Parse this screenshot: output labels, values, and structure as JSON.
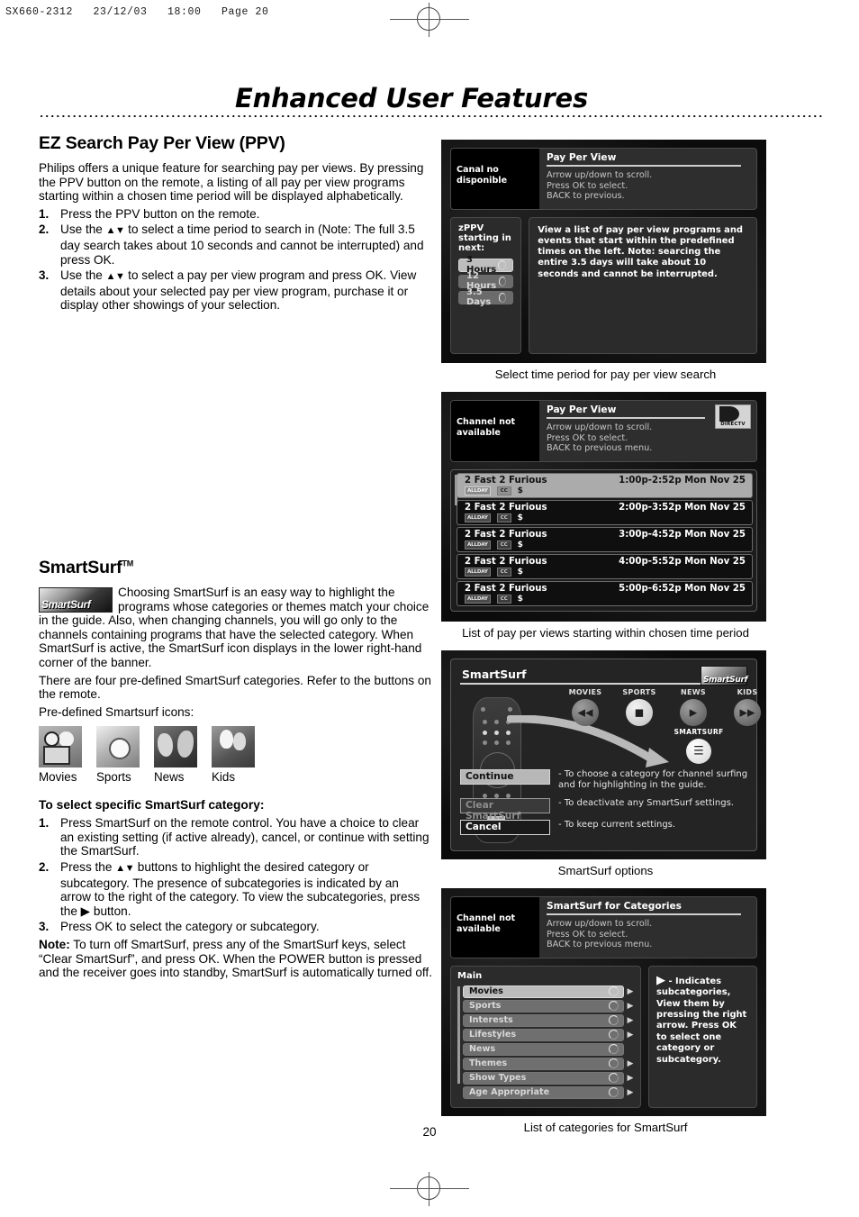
{
  "print_header": "SX660-2312   23/12/03   18:00   Page 20",
  "page_title": "Enhanced User Features",
  "page_number": "20",
  "left_column": {
    "ppv": {
      "heading": "EZ Search Pay Per View (PPV)",
      "intro": "Philips offers a unique feature for searching pay per views. By pressing the PPV button on the remote, a listing of all pay per view programs starting within a chosen time period will be displayed alphabetically.",
      "steps": [
        {
          "num": "1.",
          "text": "Press the PPV button on the remote."
        },
        {
          "num": "2.",
          "text_before": "Use the ",
          "arrows": "▲▼",
          "text_after": " to select a time period to search in (Note: The full 3.5 day search takes about 10 seconds and cannot be interrupted) and press OK."
        },
        {
          "num": "3.",
          "text_before": "Use the ",
          "arrows": "▲▼",
          "text_after": " to select a pay per view program and press OK. View details about your selected pay per view program, purchase it or display other showings of your selection."
        }
      ]
    },
    "smartsurf": {
      "heading": "SmartSurf",
      "heading_tm": "TM",
      "logo_text": "SmartSurf",
      "para1": "Choosing SmartSurf is an easy way to highlight the programs whose categories or themes match your choice in the guide. Also, when changing channels, you will go only to the channels containing programs that have the selected category. When SmartSurf is active, the SmartSurf icon displays in the lower right-hand corner of the banner.",
      "para2": "There are four pre-defined SmartSurf categories. Refer to the buttons on the remote.",
      "para3": "Pre-defined Smartsurf icons:",
      "icons": [
        {
          "label": "Movies",
          "icon": "movies-icon"
        },
        {
          "label": "Sports",
          "icon": "sports-icon"
        },
        {
          "label": "News",
          "icon": "news-icon"
        },
        {
          "label": "Kids",
          "icon": "kids-icon"
        }
      ]
    },
    "select_category": {
      "heading": "To select specific SmartSurf category:",
      "steps": [
        {
          "num": "1.",
          "text": "Press SmartSurf on the remote control. You have a choice to clear an existing setting (if active already), cancel, or continue with setting the SmartSurf."
        },
        {
          "num": "2.",
          "text_before": "Press the ",
          "arrows": "▲▼",
          "text_after": " buttons to highlight the desired category or subcategory. The presence of subcategories is indicated by an arrow to the right of the category. To view the subcategories, press the ▶ button."
        },
        {
          "num": "3.",
          "text": "Press OK to select the category or subcategory."
        }
      ],
      "note_label": "Note:",
      "note_text": " To turn off SmartSurf, press any of the SmartSurf keys, select “Clear SmartSurf”, and press OK. When the POWER button is pressed and the receiver goes into standby, SmartSurf is automatically turned off."
    }
  },
  "figures": {
    "ppv_time": {
      "caption": "Select time period for pay per view search",
      "video_text": "Canal no disponible",
      "title": "Pay Per View",
      "help_lines": [
        "Arrow up/down to scroll.",
        "Press OK to select.",
        "BACK to previous."
      ],
      "panel_caption": "zPPV starting in next:",
      "options": [
        {
          "label": "3   Hours",
          "selected": true
        },
        {
          "label": "12 Hours",
          "selected": false
        },
        {
          "label": "3.5 Days",
          "selected": false
        }
      ],
      "info_text": "View a list of pay per view programs and events that start within the predefined times on the left. Note: searcing the entire 3.5 days will take about 10 seconds and cannot be interrupted."
    },
    "ppv_list": {
      "caption": "List of pay per views starting within chosen time period",
      "video_text": "Channel not available",
      "title": "Pay Per View",
      "help_lines": [
        "Arrow up/down to scroll.",
        "Press OK to select.",
        "BACK to previous menu."
      ],
      "logo_text": "DIRECTV",
      "badges": {
        "allday": "ALLDAY",
        "cc": "CC",
        "dollar": "$"
      },
      "items": [
        {
          "title": "2 Fast 2 Furious",
          "time": "1:00p-2:52p Mon Nov 25",
          "selected": true
        },
        {
          "title": "2 Fast 2 Furious",
          "time": "2:00p-3:52p Mon Nov 25",
          "selected": false
        },
        {
          "title": "2 Fast 2 Furious",
          "time": "3:00p-4:52p Mon Nov 25",
          "selected": false
        },
        {
          "title": "2 Fast 2 Furious",
          "time": "4:00p-5:52p Mon Nov 25",
          "selected": false
        },
        {
          "title": "2 Fast 2 Furious",
          "time": "5:00p-6:52p Mon Nov 25",
          "selected": false
        }
      ]
    },
    "smartsurf_options": {
      "caption": "SmartSurf options",
      "title": "SmartSurf",
      "badge_text": "SmartSurf",
      "category_buttons": [
        {
          "label": "MOVIES",
          "glyph": "◀◀",
          "style": "dark"
        },
        {
          "label": "SPORTS",
          "glyph": "■",
          "style": "light"
        },
        {
          "label": "NEWS",
          "glyph": "▶",
          "style": "dark"
        },
        {
          "label": "KIDS",
          "glyph": "▶▶",
          "style": "dark"
        }
      ],
      "smartsurf_button": {
        "label": "SMARTSURF",
        "glyph": "☰"
      },
      "options": [
        {
          "label": "Continue",
          "style": "hi",
          "desc": "- To choose a category for channel surfing and for highlighting in the guide."
        },
        {
          "label": "Clear SmartSurf",
          "style": "dim",
          "desc": "- To deactivate any SmartSurf settings."
        },
        {
          "label": "Cancel",
          "style": "pl",
          "desc": "- To keep current settings."
        }
      ]
    },
    "smartsurf_categories": {
      "caption": "List of categories for SmartSurf",
      "video_text": "Channel not available",
      "title": "SmartSurf for Categories",
      "help_lines": [
        "Arrow up/down to scroll.",
        "Press OK to select.",
        "BACK to previous menu."
      ],
      "main_label": "Main",
      "categories": [
        {
          "label": "Movies",
          "selected": true,
          "has_sub": true
        },
        {
          "label": "Sports",
          "selected": false,
          "has_sub": true
        },
        {
          "label": "Interests",
          "selected": false,
          "has_sub": true
        },
        {
          "label": "Lifestyles",
          "selected": false,
          "has_sub": true
        },
        {
          "label": "News",
          "selected": false,
          "has_sub": false
        },
        {
          "label": "Themes",
          "selected": false,
          "has_sub": true
        },
        {
          "label": "Show Types",
          "selected": false,
          "has_sub": true
        },
        {
          "label": "Age Appropriate",
          "selected": false,
          "has_sub": true
        }
      ],
      "info_arrow": "▶",
      "info_text": "- Indicates subcategories, View them by pressing the right arrow. Press OK to select one category or subcategory."
    }
  }
}
